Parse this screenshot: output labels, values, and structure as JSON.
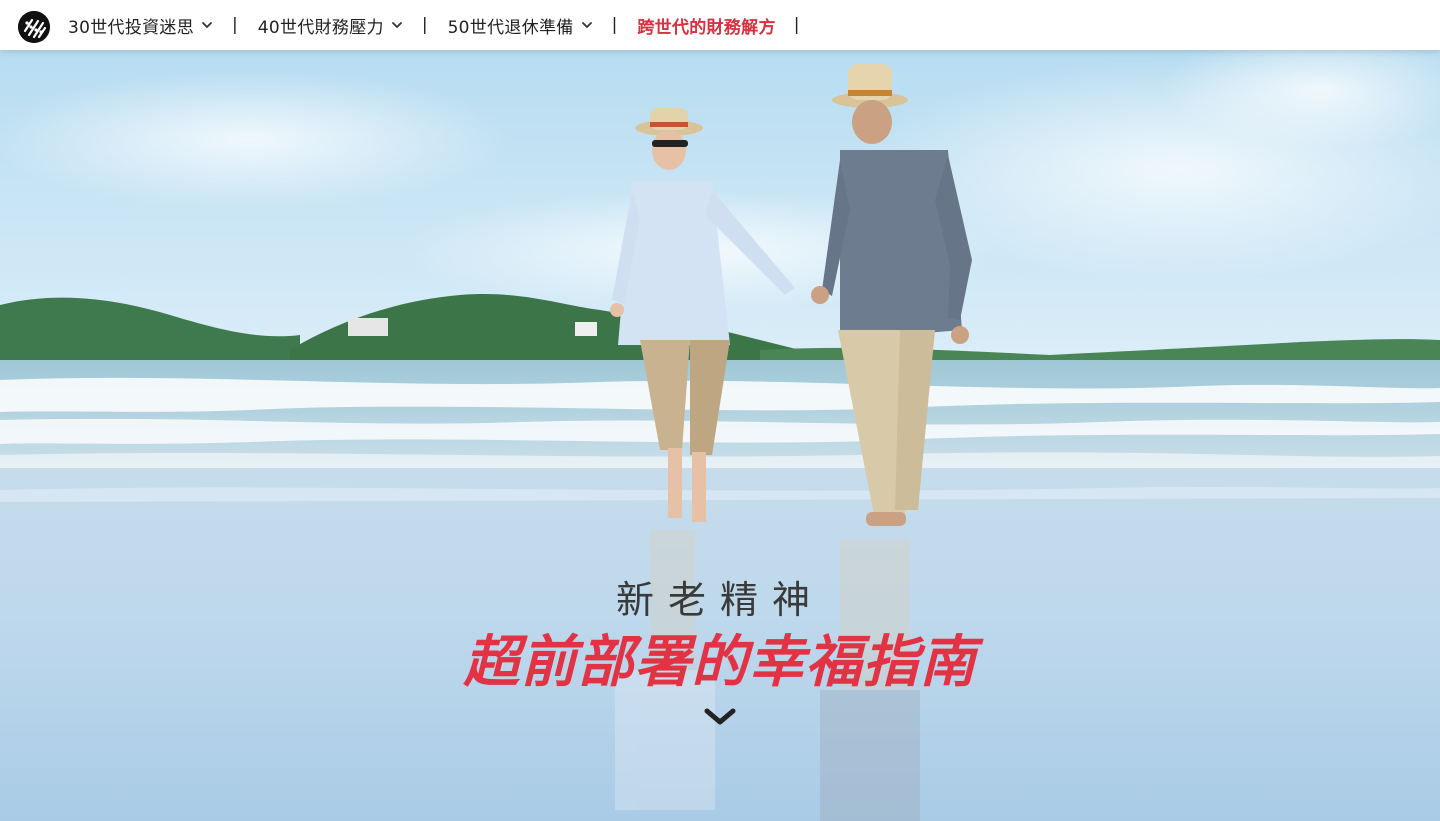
{
  "header": {
    "logo_icon": "brand-logo-icon",
    "nav": [
      {
        "label": "30世代投資迷思",
        "has_dropdown": true
      },
      {
        "label": "40世代財務壓力",
        "has_dropdown": true
      },
      {
        "label": "50世代退休準備",
        "has_dropdown": true
      },
      {
        "label": "跨世代的財務解方",
        "has_dropdown": false,
        "active": true
      }
    ],
    "separator": "|",
    "active_color": "#d8303f"
  },
  "hero": {
    "subtitle": "新老精神",
    "title": "超前部署的幸福指南",
    "title_color": "#e23344",
    "scroll_icon": "chevron-down-icon"
  }
}
